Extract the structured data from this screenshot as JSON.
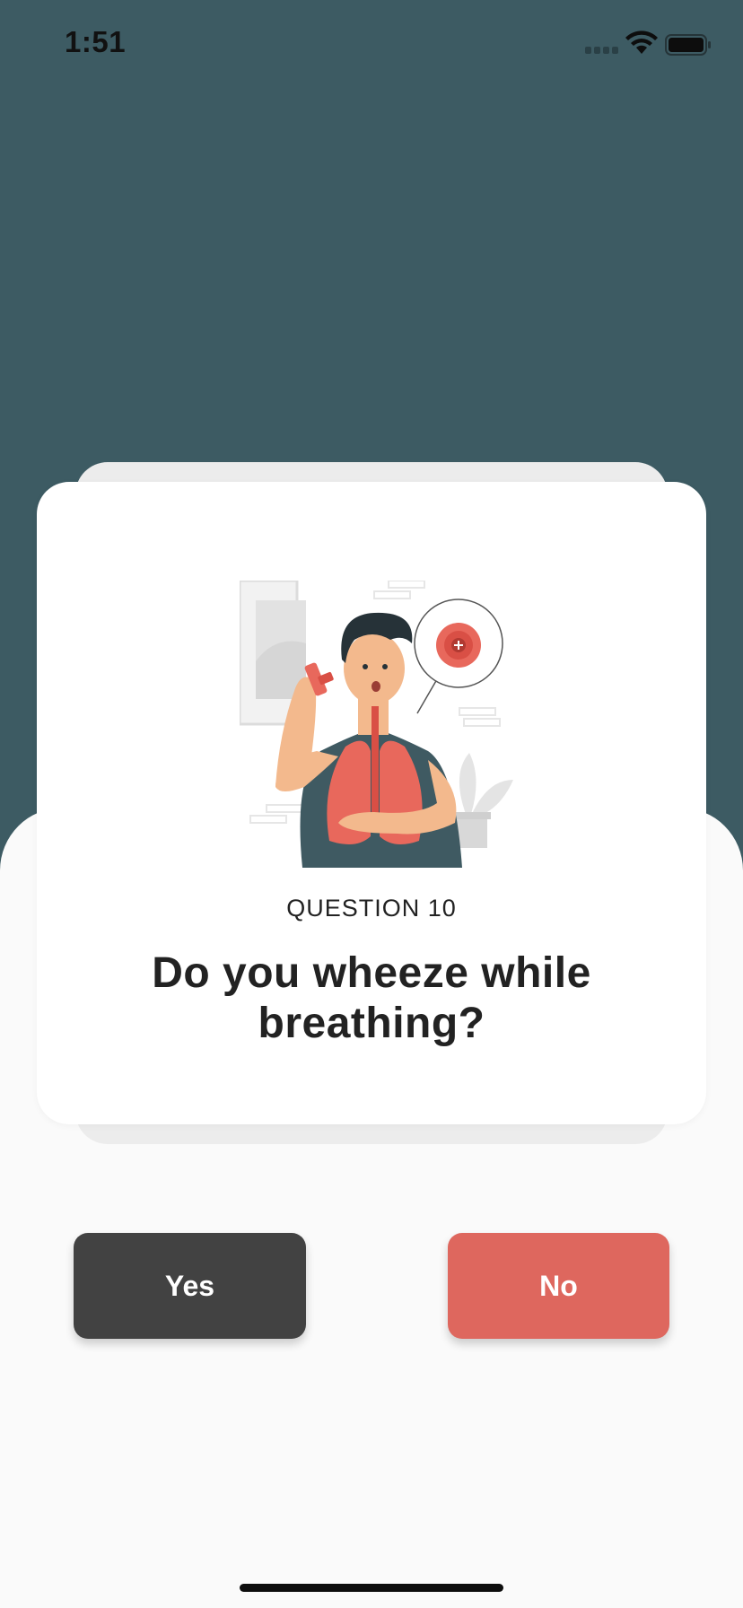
{
  "status_bar": {
    "time": "1:51"
  },
  "card": {
    "question_label": "QUESTION 10",
    "question_text": "Do you wheeze while breathing?",
    "illustration_icon": "asthma-inhaler-lungs-illustration"
  },
  "buttons": {
    "yes_label": "Yes",
    "no_label": "No"
  },
  "colors": {
    "header_bg": "#3d5b63",
    "page_bg": "#fafafa",
    "yes_button": "#424242",
    "no_button": "#de675e",
    "accent_illustration": "#e8685c"
  }
}
